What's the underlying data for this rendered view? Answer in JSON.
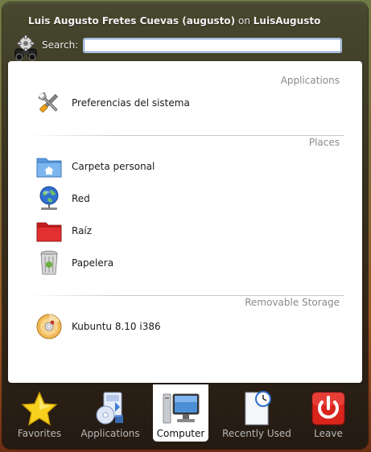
{
  "header": {
    "user_name": "Luis Augusto Fretes Cuevas (augusto)",
    "on_text": "on",
    "host": "LuisAugusto"
  },
  "search": {
    "label": "Search:",
    "value": "",
    "icon": "binoculars-gear-icon"
  },
  "sections": [
    {
      "title": "Applications",
      "items": [
        {
          "label": "Preferencias del sistema",
          "icon": "wrench-screwdriver-icon"
        }
      ]
    },
    {
      "title": "Places",
      "items": [
        {
          "label": "Carpeta personal",
          "icon": "home-folder-icon"
        },
        {
          "label": "Red",
          "icon": "network-globe-icon"
        },
        {
          "label": "Raíz",
          "icon": "red-folder-icon"
        },
        {
          "label": "Papelera",
          "icon": "trash-icon"
        }
      ]
    },
    {
      "title": "Removable Storage",
      "items": [
        {
          "label": "Kubuntu 8.10 i386",
          "icon": "cd-disc-icon"
        }
      ]
    }
  ],
  "tabs": [
    {
      "label": "Favorites",
      "icon": "star-icon",
      "active": false
    },
    {
      "label": "Applications",
      "icon": "applications-icon",
      "active": false
    },
    {
      "label": "Computer",
      "icon": "computer-icon",
      "active": true
    },
    {
      "label": "Recently Used",
      "icon": "recent-document-icon",
      "active": false
    },
    {
      "label": "Leave",
      "icon": "power-icon",
      "active": false
    }
  ],
  "colors": {
    "accent_blue": "#4d8fd6",
    "leave_red": "#d9251c",
    "star_yellow": "#f7d11e"
  }
}
